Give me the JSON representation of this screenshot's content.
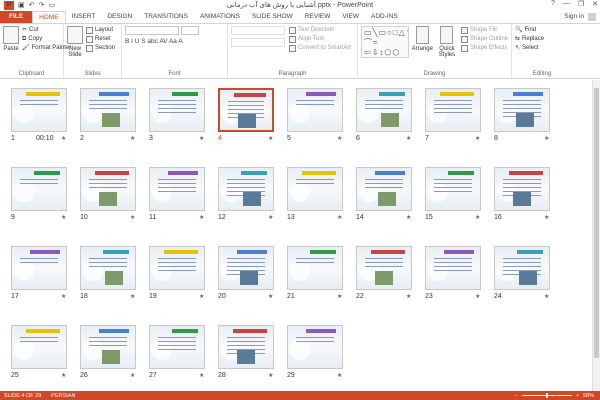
{
  "titlebar": {
    "app_logo": "P",
    "title": "آشنایی با روش های آب درمانی.pptx - PowerPoint",
    "qat_icons": [
      "save-icon",
      "undo-icon",
      "redo-icon",
      "slideshow-icon"
    ],
    "window_controls": [
      "?",
      "—",
      "❐",
      "✕"
    ]
  },
  "tabs": {
    "file": "FILE",
    "items": [
      "HOME",
      "INSERT",
      "DESIGN",
      "TRANSITIONS",
      "ANIMATIONS",
      "SLIDE SHOW",
      "REVIEW",
      "VIEW",
      "ADD-INS"
    ],
    "active": "HOME",
    "signin": "Sign in"
  },
  "ribbon": {
    "clipboard": {
      "label": "Clipboard",
      "paste": "Paste",
      "cut": "Cut",
      "copy": "Copy",
      "format_painter": "Format Painter"
    },
    "slides": {
      "label": "Slides",
      "new_slide": "New",
      "new_slide_2": "Slide",
      "layout": "Layout",
      "reset": "Reset",
      "section": "Section"
    },
    "font": {
      "label": "Font",
      "format_glyphs": "B I U S abc AV Aa A"
    },
    "paragraph": {
      "label": "Paragraph",
      "text_direction": "Text Direction",
      "align_text": "Align Text",
      "convert_smartart": "Convert to SmartArt"
    },
    "drawing": {
      "label": "Drawing",
      "arrange": "Arrange",
      "quick_styles": "Quick Styles",
      "shape_fill": "Shape Fill",
      "shape_outline": "Shape Outline",
      "shape_effects": "Shape Effects",
      "shapes_glyphs": "▭╲▭○□△↘⇨◇☆{}⌒≈ ⇦⇩↕⬠⬡"
    },
    "editing": {
      "label": "Editing",
      "find": "Find",
      "replace": "Replace",
      "select": "Select"
    }
  },
  "slides": [
    {
      "num": "1",
      "extra": "00:10"
    },
    {
      "num": "2"
    },
    {
      "num": "3"
    },
    {
      "num": "4",
      "selected": true
    },
    {
      "num": "5"
    },
    {
      "num": "6"
    },
    {
      "num": "7"
    },
    {
      "num": "8"
    },
    {
      "num": "9"
    },
    {
      "num": "10"
    },
    {
      "num": "11"
    },
    {
      "num": "12"
    },
    {
      "num": "13"
    },
    {
      "num": "14"
    },
    {
      "num": "15"
    },
    {
      "num": "16"
    },
    {
      "num": "17"
    },
    {
      "num": "18"
    },
    {
      "num": "19"
    },
    {
      "num": "20"
    },
    {
      "num": "21"
    },
    {
      "num": "22"
    },
    {
      "num": "23"
    },
    {
      "num": "24"
    },
    {
      "num": "25"
    },
    {
      "num": "26"
    },
    {
      "num": "27"
    },
    {
      "num": "28"
    },
    {
      "num": "29"
    }
  ],
  "status": {
    "slide_of": "SLIDE 4 OF 29",
    "language": "PERSIAN",
    "zoom": "58%",
    "zoom_minus": "−",
    "zoom_plus": "+"
  },
  "colors": {
    "accent": "#d24726",
    "selection": "#d24726"
  }
}
